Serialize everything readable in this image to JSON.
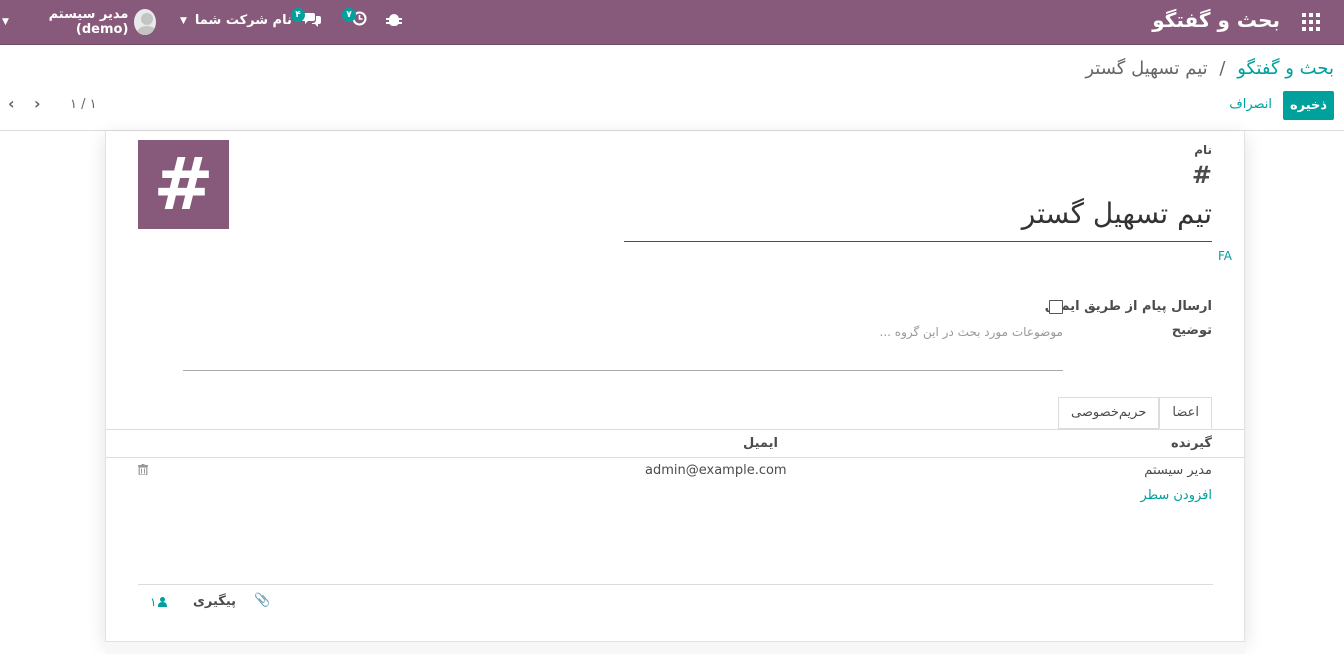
{
  "navbar": {
    "brand": "بحث و گفتگو",
    "company": "نام شرکت شما",
    "user": "مدیر سیستم (demo)",
    "messages_count": "۴",
    "activities_count": "۷",
    "color": "#875a7b"
  },
  "breadcrumb": {
    "parent": "بحث و گفتگو",
    "separator": "/",
    "current": "تیم تسهیل گستر"
  },
  "actions": {
    "save": "ذخیره",
    "discard": "انصراف"
  },
  "pager": {
    "value": "۱ / ۱"
  },
  "form": {
    "name_label": "نام",
    "hash": "#",
    "name_value": "تیم تسهیل گستر",
    "lang": "FA",
    "email_label": "ارسال پیام از طریق ایمیل",
    "email_checked": false,
    "description_label": "توضیح",
    "description_placeholder": "موضوعات مورد بحث در این گروه ...",
    "image_symbol": "#"
  },
  "tabs": [
    {
      "label": "حریم‌خصوصی",
      "active": false
    },
    {
      "label": "اعضا",
      "active": true
    }
  ],
  "members": {
    "headers": {
      "recipient": "گیرنده",
      "email": "ایمیل"
    },
    "rows": [
      {
        "recipient": "مدیر سیستم",
        "email": "admin@example.com"
      }
    ],
    "add_line": "افزودن سطر"
  },
  "chatter": {
    "follow": "پیگیری",
    "followers": "۱"
  },
  "colors": {
    "accent": "#00a09d",
    "brand": "#875a7b"
  }
}
